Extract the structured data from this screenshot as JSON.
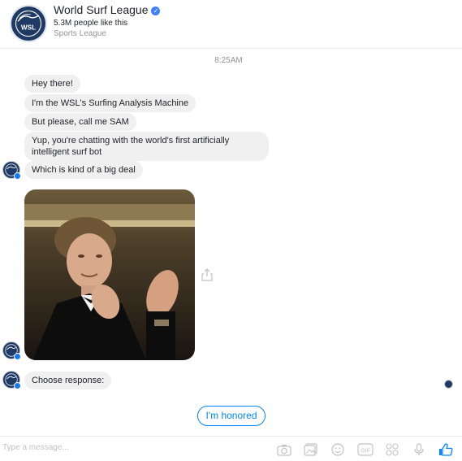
{
  "page": {
    "name": "World Surf League",
    "likes": "5.3M people like this",
    "category": "Sports League",
    "logo_text": "WSL"
  },
  "conversation": {
    "timestamp": "8:25AM",
    "messages": [
      "Hey there!",
      "I'm the WSL's Surfing Analysis Machine",
      "But please, call me SAM",
      "Yup, you're chatting with the world's first artificially intelligent surf bot",
      "Which is kind of a big deal"
    ],
    "prompt": "Choose response:"
  },
  "quick_reply": {
    "label": "I'm honored"
  },
  "composer": {
    "placeholder": "Type a message...",
    "tools": [
      "camera-icon",
      "photo-icon",
      "emoji-icon",
      "gif-icon",
      "stickers-icon",
      "microphone-icon",
      "thumbs-up-icon"
    ],
    "gif_label": "GIF"
  },
  "colors": {
    "accent": "#0084ff",
    "bubble": "#f1f0f0",
    "logo_navy": "#1f3a64"
  }
}
